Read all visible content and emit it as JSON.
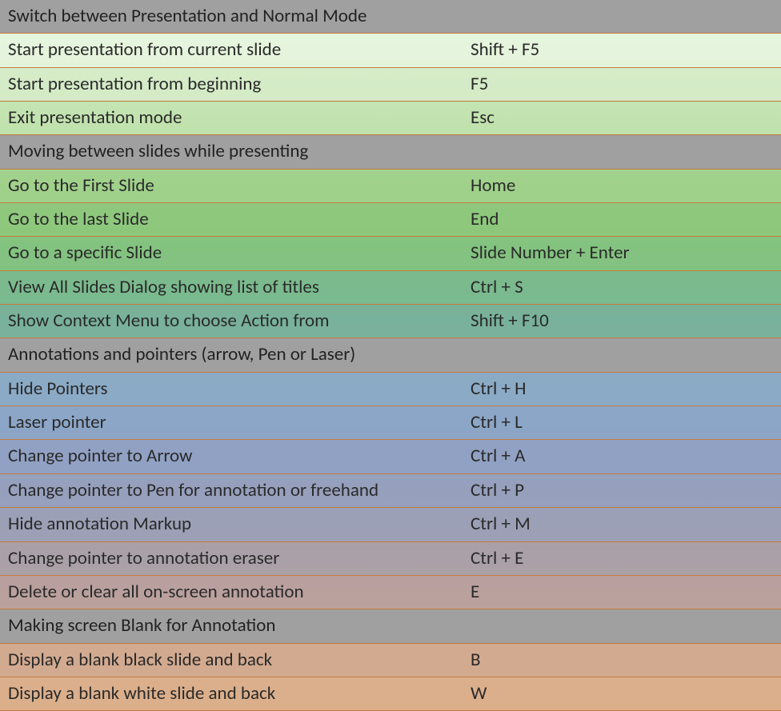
{
  "sections": [
    {
      "title": "Switch between Presentation and Normal Mode",
      "rows": [
        {
          "desc": "Start presentation from current slide",
          "key": "Shift + F5",
          "tint": "tint-green-1"
        },
        {
          "desc": "Start presentation from beginning",
          "key": "F5",
          "tint": "tint-green-2"
        },
        {
          "desc": "Exit presentation mode",
          "key": "Esc",
          "tint": "tint-green-3"
        }
      ]
    },
    {
      "title": "Moving between slides while presenting",
      "rows": [
        {
          "desc": "Go to the First Slide",
          "key": "Home",
          "tint": "tint-green-4"
        },
        {
          "desc": "Go to the last Slide",
          "key": "End",
          "tint": "tint-green-5"
        },
        {
          "desc": "Go to a specific Slide",
          "key": "Slide Number + Enter",
          "tint": "tint-green-6"
        },
        {
          "desc": "View All Slides Dialog showing list of titles",
          "key": "Ctrl + S",
          "tint": "tint-teal-1"
        },
        {
          "desc": "Show Context Menu to choose Action from",
          "key": "Shift + F10",
          "tint": "tint-teal-2"
        }
      ]
    },
    {
      "title": "Annotations and pointers (arrow, Pen or Laser)",
      "rows": [
        {
          "desc": "Hide Pointers",
          "key": "Ctrl + H",
          "tint": "tint-blue-1"
        },
        {
          "desc": "Laser pointer",
          "key": "Ctrl + L",
          "tint": "tint-blue-2"
        },
        {
          "desc": "Change pointer to Arrow",
          "key": "Ctrl + A",
          "tint": "tint-blue-3"
        },
        {
          "desc": "Change pointer to Pen for annotation or freehand",
          "key": "Ctrl +  P",
          "tint": "tint-blue-4"
        },
        {
          "desc": "Hide annotation Markup",
          "key": "Ctrl + M",
          "tint": "tint-blue-5"
        },
        {
          "desc": "Change pointer to annotation eraser",
          "key": "Ctrl + E",
          "tint": "tint-mauve-1"
        },
        {
          "desc": "Delete or clear all on-screen annotation",
          "key": "E",
          "tint": "tint-mauve-2"
        }
      ]
    },
    {
      "title": "Making screen Blank for Annotation",
      "rows": [
        {
          "desc": "Display a blank black slide and back",
          "key": "B",
          "tint": "tint-peach-1"
        },
        {
          "desc": "Display a blank white slide and back",
          "key": "W",
          "tint": "tint-peach-2"
        }
      ]
    }
  ]
}
